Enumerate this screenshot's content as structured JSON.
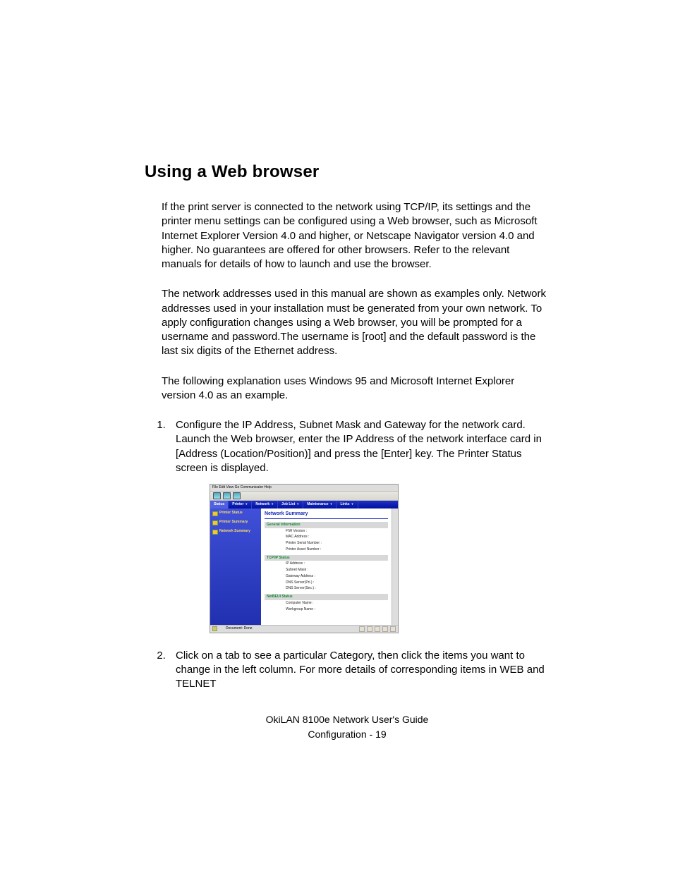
{
  "heading": "Using a Web browser",
  "paragraphs": {
    "p1": "If the print server is connected to the network using TCP/IP, its settings and the printer menu settings can be configured using a Web browser, such as Microsoft Internet Explorer Version 4.0 and higher, or Netscape Navigator version 4.0 and higher. No guarantees are offered for other browsers. Refer to the relevant manuals for details of how to launch and use the browser.",
    "p2": "The network addresses used in this manual are shown as examples only. Network addresses used in your installation must be generated from your own network. To apply configuration changes using a Web browser, you will be prompted for a username and password.The username is [root] and the default password is the last six digits of the Ethernet address.",
    "p3": "The following explanation uses Windows 95 and Microsoft Internet Explorer version 4.0 as an example."
  },
  "steps": {
    "s1": "Configure the IP Address, Subnet Mask and Gateway for the network card. Launch the Web browser, enter the IP Address of the network interface card in [Address (Location/Position)] and press the [Enter] key. The Printer Status screen is displayed.",
    "s2": "Click on a tab to see a particular Category, then click the items you want to change in the left column. For more details of corresponding items in WEB and TELNET"
  },
  "screenshot": {
    "menubar": "File  Edit  View  Go  Communicator  Help",
    "tabs": [
      "Status",
      "Printer",
      "Network",
      "Job List",
      "Maintenance",
      "Links"
    ],
    "sidebar": [
      "Printer Status",
      "Printer Summary",
      "Network Summary"
    ],
    "content_title": "Network Summary",
    "sections": {
      "general": {
        "title": "General Information",
        "rows": [
          "F/W Version :",
          "MAC Address :",
          "Printer Serial Number :",
          "Printer Asset Number :"
        ]
      },
      "tcpip": {
        "title": "TCP/IP Status",
        "rows": [
          "IP Address :",
          "Subnet Mask :",
          "Gateway Address :",
          "DNS Server(Pri.) :",
          "DNS Server(Sec.) :"
        ]
      },
      "netbeui": {
        "title": "NetBEUI Status",
        "rows": [
          "Computer Name :",
          "Workgroup Name :"
        ]
      }
    },
    "footer_status": "Document: Done"
  },
  "footer": {
    "line1": "OkiLAN 8100e Network User's Guide",
    "line2_a": "Configuration   -   ",
    "line2_b": "19"
  }
}
